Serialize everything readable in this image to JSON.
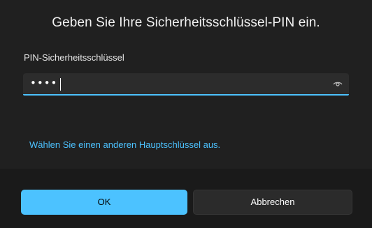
{
  "dialog": {
    "title": "Geben Sie Ihre Sicherheitsschlüssel-PIN ein.",
    "pin_label": "PIN-Sicherheitsschlüssel",
    "pin_masked": "••••",
    "reveal_icon": "eye-icon",
    "alt_key_link": "Wählen Sie einen anderen Hauptschlüssel aus."
  },
  "buttons": {
    "ok_label": "OK",
    "cancel_label": "Abbrechen"
  },
  "colors": {
    "accent": "#4cc2ff",
    "background": "#202020",
    "footer": "#1a1a1a"
  }
}
